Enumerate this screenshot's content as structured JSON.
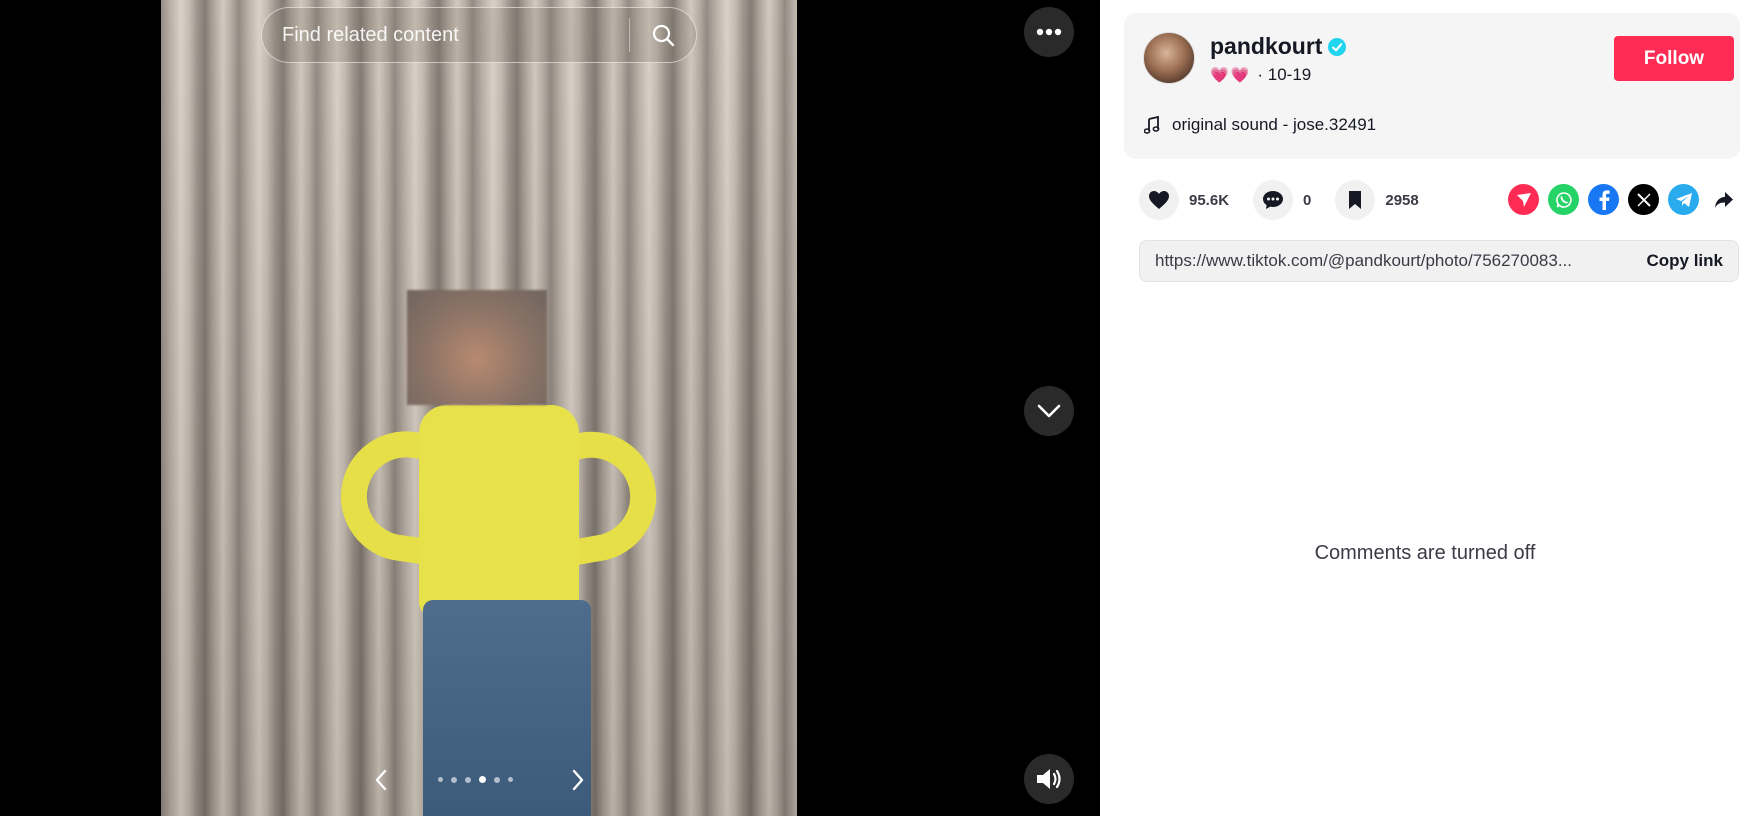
{
  "search": {
    "placeholder": "Find related content"
  },
  "viewer": {
    "carousel": {
      "total": 6,
      "active_index": 3
    }
  },
  "author": {
    "username": "pandkourt",
    "verified": true,
    "hearts": "💗💗",
    "date": "· 10-19",
    "follow_label": "Follow"
  },
  "music": {
    "title": "original sound - jose.32491"
  },
  "stats": {
    "likes": "95.6K",
    "comments": "0",
    "saves": "2958"
  },
  "share": {
    "items": [
      "repost-icon",
      "whatsapp-icon",
      "facebook-icon",
      "x-icon",
      "telegram-icon",
      "share-arrow-icon"
    ],
    "colors": {
      "repost": "#fe2c55",
      "whatsapp": "#25d366",
      "facebook": "#1877f2",
      "x": "#000000",
      "telegram": "#2aabee"
    }
  },
  "link": {
    "url": "https://www.tiktok.com/@pandkourt/photo/756270083...",
    "copy_label": "Copy link"
  },
  "comments": {
    "status": "Comments are turned off"
  },
  "colors": {
    "accent": "#fe2c55",
    "verified": "#20d5ec"
  }
}
